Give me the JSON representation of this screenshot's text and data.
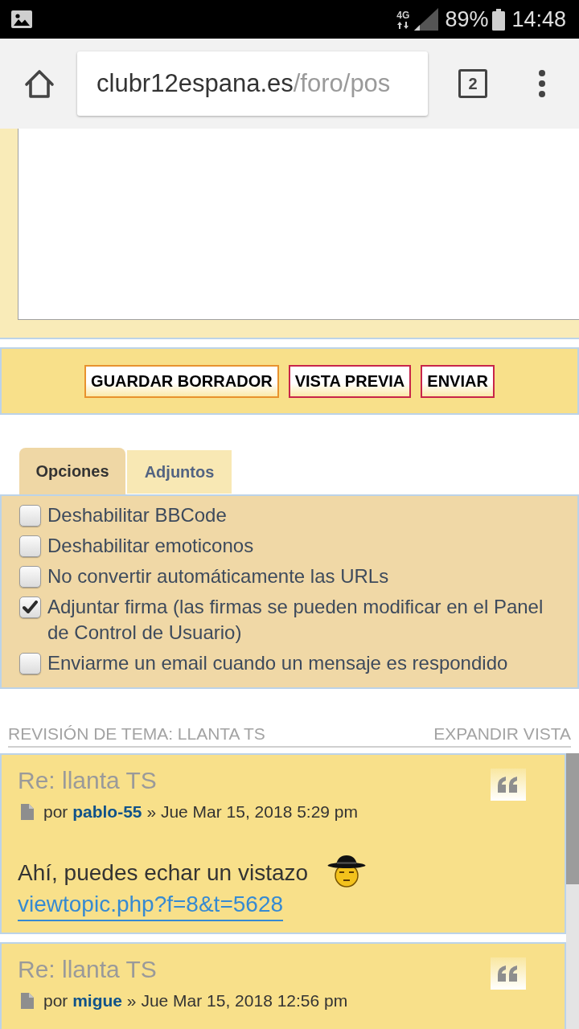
{
  "status_bar": {
    "network": "4G",
    "battery": "89%",
    "time": "14:48"
  },
  "browser": {
    "url_host": "clubr12espana.es",
    "url_path": "/foro/pos",
    "tab_count": "2"
  },
  "buttons": [
    {
      "label": "GUARDAR BORRADOR",
      "kind": "save"
    },
    {
      "label": "VISTA PREVIA",
      "kind": "preview"
    },
    {
      "label": "ENVIAR",
      "kind": "submit"
    }
  ],
  "tabs": [
    {
      "label": "Opciones",
      "selected": true
    },
    {
      "label": "Adjuntos",
      "selected": false
    }
  ],
  "options": [
    {
      "label": "Deshabilitar BBCode",
      "checked": false
    },
    {
      "label": "Deshabilitar emoticonos",
      "checked": false
    },
    {
      "label": "No convertir automáticamente las URLs",
      "checked": false
    },
    {
      "label": "Adjuntar firma (las firmas se pueden modificar en el Panel de Control de Usuario)",
      "checked": true
    },
    {
      "label": "Enviarme un email cuando un mensaje es respondido",
      "checked": false
    }
  ],
  "topic_review": {
    "title": "REVISIÓN DE TEMA: LLANTA TS",
    "expand": "EXPANDIR VISTA"
  },
  "posts": [
    {
      "title": "Re: llanta TS",
      "posted_by": "por",
      "author": "pablo-55",
      "posted_at": "» Jue Mar 15, 2018 5:29 pm",
      "body": "Ahí, puedes echar un vistazo",
      "smiley": true,
      "link": "viewtopic.php?f=8&t=5628"
    },
    {
      "title": "Re: llanta TS",
      "posted_by": "por",
      "author": "migue",
      "posted_at": "» Jue Mar 15, 2018 12:56 pm"
    }
  ]
}
